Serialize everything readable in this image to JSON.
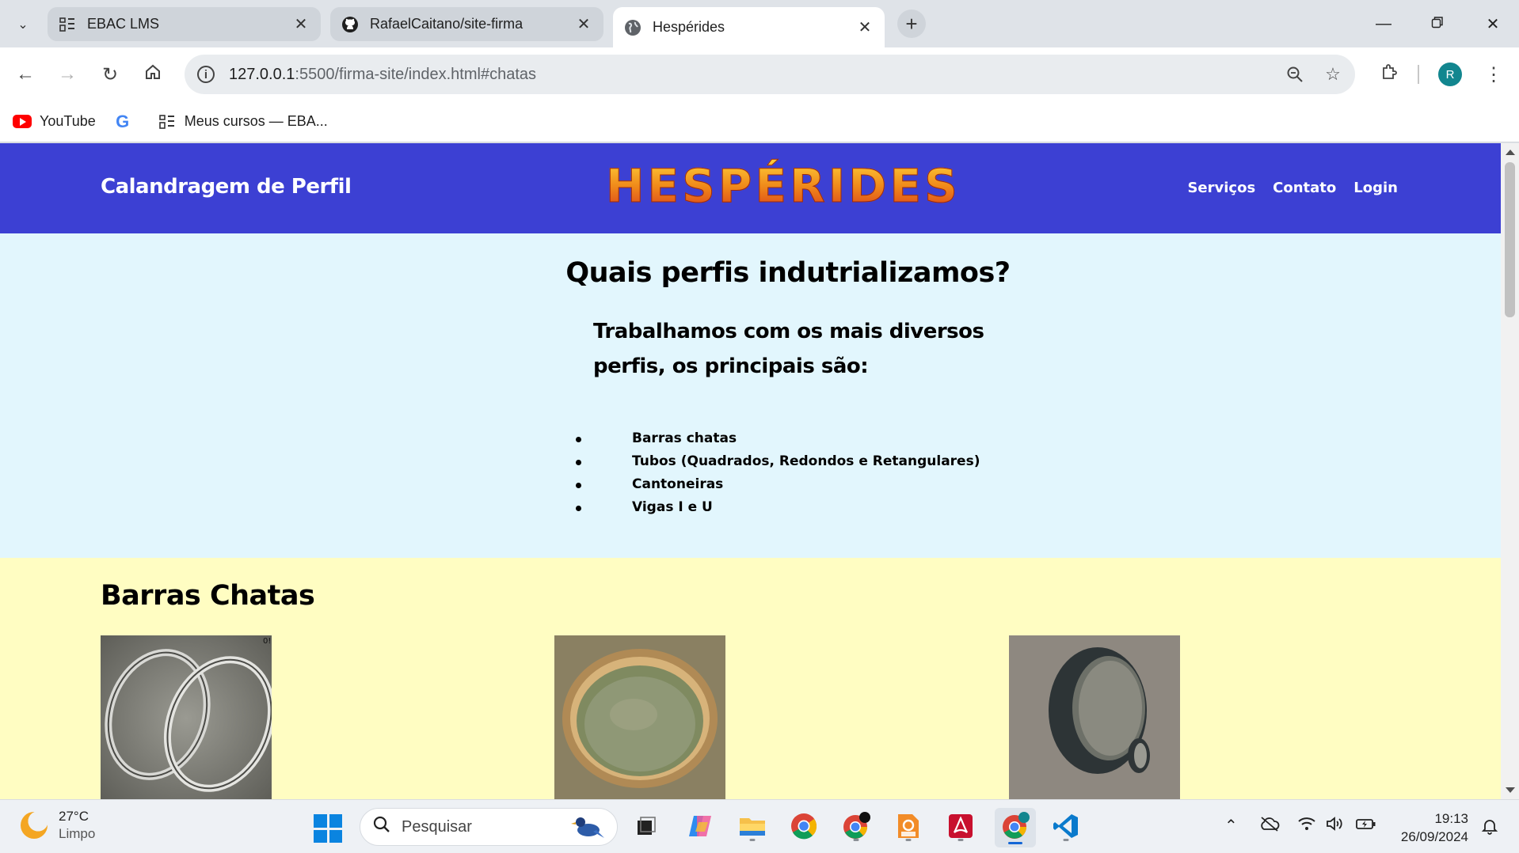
{
  "browser": {
    "tabs": [
      {
        "title": "EBAC LMS",
        "icon": "ebac-icon"
      },
      {
        "title": "RafaelCaitano/site-firma",
        "icon": "github-icon"
      },
      {
        "title": "Hespérides",
        "icon": "globe-icon"
      }
    ],
    "url_host": "127.0.0.1",
    "url_rest": ":5500/firma-site/index.html#chatas",
    "avatar_initial": "R",
    "bookmarks": [
      {
        "label": "YouTube",
        "icon": "youtube-icon"
      },
      {
        "label": "",
        "icon": "google-icon"
      },
      {
        "label": "Meus cursos — EBA...",
        "icon": "ebac-icon"
      }
    ]
  },
  "site": {
    "brand": "Calandragem de Perfil",
    "logo": "HESPÉRIDES",
    "nav": [
      "Serviços",
      "Contato",
      "Login"
    ],
    "colors": {
      "header": "#3c40d3",
      "section1": "#e2f6fd",
      "section2": "#fffdc2"
    }
  },
  "perfis": {
    "heading": "Quais perfis indutrializamos?",
    "subheading": "Trabalhamos com os mais diversos perfis, os principais são:",
    "items": [
      "Barras chatas",
      "Tubos (Quadrados, Redondos e Retangulares)",
      "Cantoneiras",
      "Vigas I e U"
    ]
  },
  "barras": {
    "heading": "Barras Chatas",
    "photo_label": "0!"
  },
  "taskbar": {
    "temperature": "27°C",
    "condition": "Limpo",
    "search_placeholder": "Pesquisar",
    "time": "19:13",
    "date": "26/09/2024"
  }
}
